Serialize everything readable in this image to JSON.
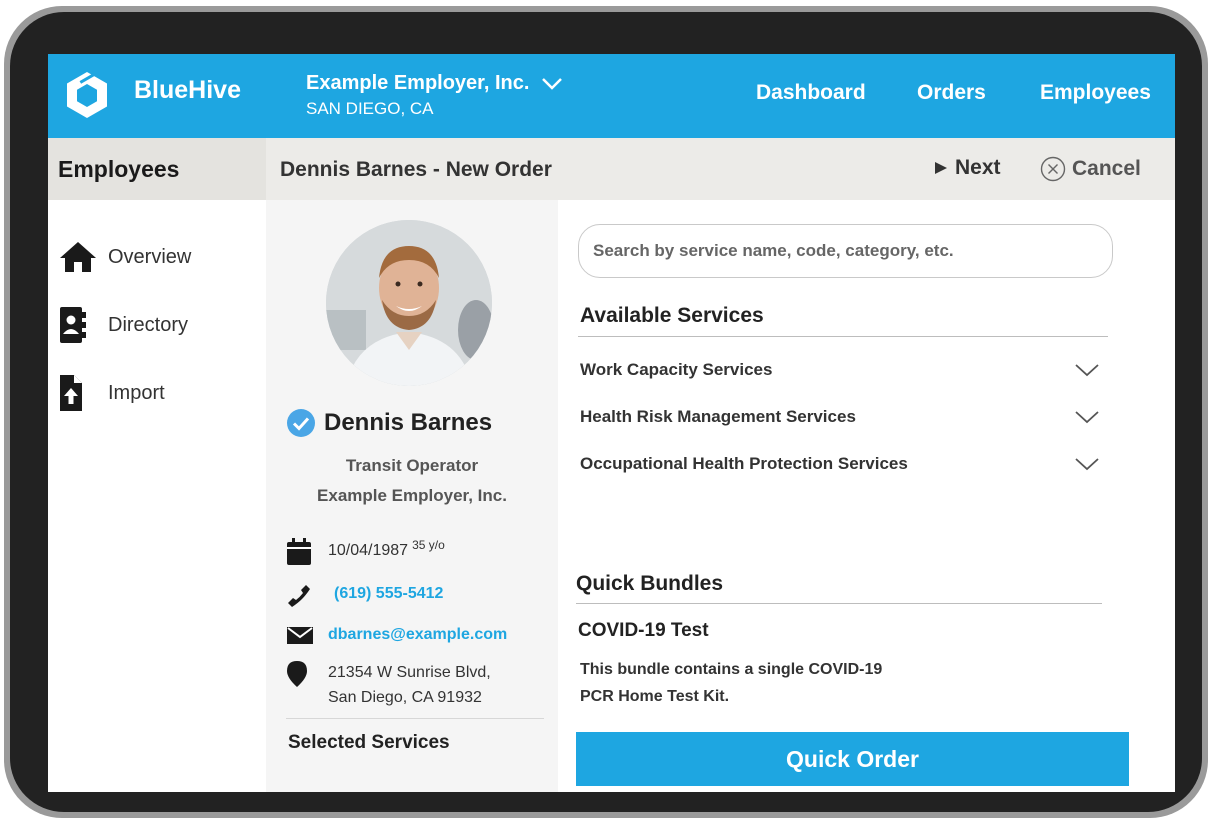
{
  "header": {
    "brand": "BlueHive",
    "employer": "Example Employer, Inc.",
    "location": "SAN DIEGO, CA",
    "nav": [
      "Dashboard",
      "Orders",
      "Employees"
    ]
  },
  "subheader": {
    "section": "Employees",
    "order_title": "Dennis Barnes - New Order",
    "next_label": "Next",
    "cancel_label": "Cancel"
  },
  "sidebar": {
    "items": [
      {
        "label": "Overview",
        "icon": "home-icon"
      },
      {
        "label": "Directory",
        "icon": "contact-book-icon"
      },
      {
        "label": "Import",
        "icon": "file-upload-icon"
      }
    ]
  },
  "employee": {
    "name": "Dennis Barnes",
    "job_title": "Transit Operator",
    "company": "Example Employer, Inc.",
    "dob": "10/04/1987",
    "age": "35 y/o",
    "phone": "(619) 555-5412",
    "email": "dbarnes@example.com",
    "address_line1": "21354 W Sunrise Blvd,",
    "address_line2": "San Diego, CA 91932"
  },
  "selected_services": {
    "title": "Selected Services"
  },
  "search": {
    "placeholder": "Search by service name, code, category, etc."
  },
  "available_services": {
    "title": "Available Services",
    "categories": [
      "Work Capacity Services",
      "Health Risk Management Services",
      "Occupational Health Protection Services"
    ]
  },
  "quick_bundles": {
    "title": "Quick Bundles",
    "bundle_name": "COVID-19 Test",
    "bundle_desc_line1": "This bundle contains a single COVID-19",
    "bundle_desc_line2": "PCR Home Test Kit.",
    "button_label": "Quick Order"
  },
  "colors": {
    "brand_blue": "#1ea6e1",
    "verified_badge": "#4aa6e6"
  }
}
